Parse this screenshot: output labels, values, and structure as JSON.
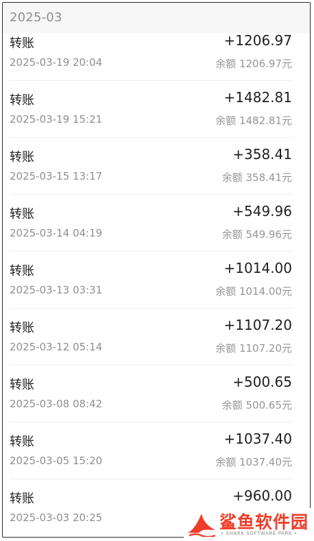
{
  "header": {
    "month": "2025-03"
  },
  "transactions": [
    {
      "title": "转账",
      "datetime": "2025-03-19 20:04",
      "amount": "+1206.97",
      "balance": "余额 1206.97元"
    },
    {
      "title": "转账",
      "datetime": "2025-03-19 15:21",
      "amount": "+1482.81",
      "balance": "余额 1482.81元"
    },
    {
      "title": "转账",
      "datetime": "2025-03-15 13:17",
      "amount": "+358.41",
      "balance": "余额 358.41元"
    },
    {
      "title": "转账",
      "datetime": "2025-03-14 04:19",
      "amount": "+549.96",
      "balance": "余额 549.96元"
    },
    {
      "title": "转账",
      "datetime": "2025-03-13 03:31",
      "amount": "+1014.00",
      "balance": "余额 1014.00元"
    },
    {
      "title": "转账",
      "datetime": "2025-03-12 05:14",
      "amount": "+1107.20",
      "balance": "余额 1107.20元"
    },
    {
      "title": "转账",
      "datetime": "2025-03-08 08:42",
      "amount": "+500.65",
      "balance": "余额 500.65元"
    },
    {
      "title": "转账",
      "datetime": "2025-03-05 15:20",
      "amount": "+1037.40",
      "balance": "余额 1037.40元"
    },
    {
      "title": "转账",
      "datetime": "2025-03-03 20:25",
      "amount": "+960.00",
      "balance": ""
    }
  ],
  "watermark": {
    "name": "鲨鱼软件园",
    "subtitle": "• SHARK SOFTWARE PARK •",
    "icon": "shark-logo",
    "color": "#ef3d29"
  }
}
